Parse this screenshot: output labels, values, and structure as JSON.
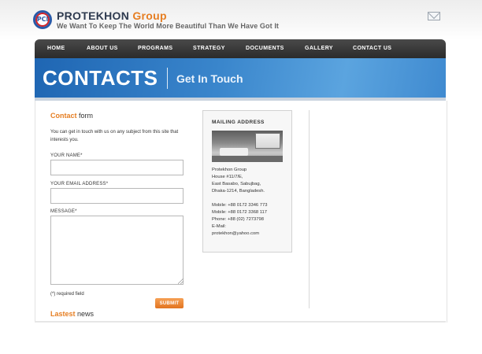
{
  "header": {
    "logo_text": "PCl",
    "brand_primary": "PROTEKHON",
    "brand_secondary": "Group",
    "tagline": "We Want To Keep The World More Beautiful Than We Have Got It",
    "mail_icon": "envelope-icon"
  },
  "nav": {
    "items": [
      "HOME",
      "ABOUT US",
      "PROGRAMS",
      "STRATEGY",
      "DOCUMENTS",
      "GALLERY",
      "CONTACT US"
    ]
  },
  "banner": {
    "title": "CONTACTS",
    "subtitle": "Get In Touch"
  },
  "contact_form": {
    "title_highlight": "Contact",
    "title_rest": "form",
    "intro": "You can get in touch with us on any subject from this site that interests you.",
    "name_label": "YOUR NAME*",
    "email_label": "YOUR EMAIL ADDRESS*",
    "message_label": "MESSAGE*",
    "name_value": "",
    "email_value": "",
    "message_value": "",
    "required_note": "(*) required field",
    "submit_label": "SUBMIT"
  },
  "mailing": {
    "title": "MAILING ADDRESS",
    "lines": [
      "Protekhon Group",
      "House #11/7/E,",
      "East Basabo, Sabujbag,",
      "Dhaka-1214, Bangladesh.",
      "",
      "Mobile: +88 0172 3346 773",
      "Mobile: +88 0172 3368 117",
      "Phone: +88 (02) 7273798",
      "E-Mail:",
      "protekhon@yahoo.com"
    ]
  },
  "news": {
    "title_highlight": "Lastest",
    "title_rest": "news"
  },
  "colors": {
    "accent_orange": "#e67e22",
    "brand_navy": "#2e3a4f",
    "banner_blue": "#2f78c0",
    "nav_dark": "#333333"
  }
}
